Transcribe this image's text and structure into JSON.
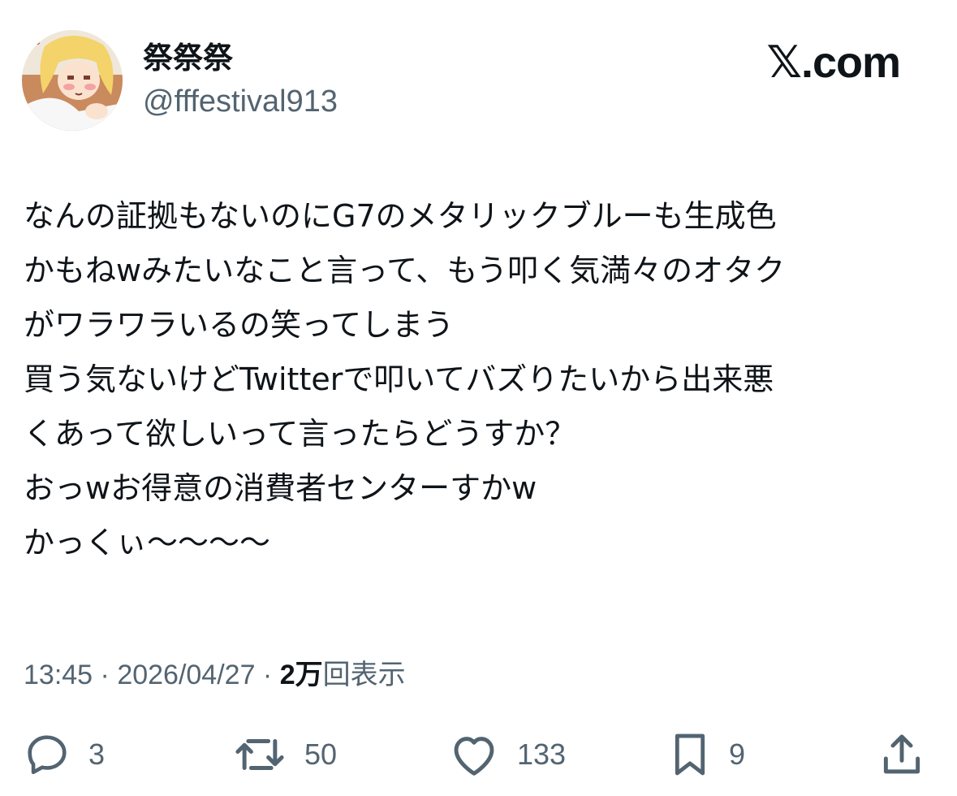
{
  "author": {
    "display_name": "祭祭祭",
    "handle": "@fffestival913",
    "avatar_icon": "anime-avatar-icon"
  },
  "brand": {
    "label": "𝕏.com"
  },
  "tweet": {
    "lines": [
      "なんの証拠もないのにG7のメタリックブルーも生成色",
      "かもねwみたいなこと言って、もう叩く気満々のオタク",
      "がワラワラいるの笑ってしまう",
      "買う気ないけどTwitterで叩いてバズりたいから出来悪",
      "くあって欲しいって言ったらどうすか？",
      "おっwお得意の消費者センターすかw",
      "かっくぃ〜〜〜〜"
    ]
  },
  "meta": {
    "time": "13:45",
    "separator": " · ",
    "date": "2026/04/27",
    "views_count": "2万",
    "views_label": "回表示"
  },
  "actions": {
    "reply_count": "3",
    "retweet_count": "50",
    "like_count": "133",
    "bookmark_count": "9",
    "icons": [
      "reply-icon",
      "retweet-icon",
      "like-icon",
      "bookmark-icon",
      "share-icon"
    ]
  },
  "colors": {
    "text_primary": "#0f1419",
    "text_secondary": "#536471",
    "background": "#ffffff"
  }
}
